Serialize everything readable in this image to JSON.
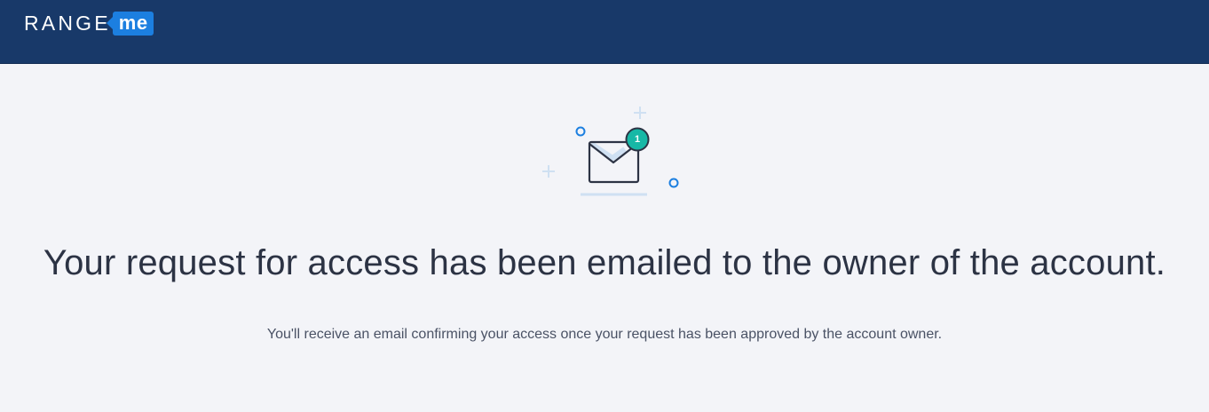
{
  "header": {
    "logo_text": "RANGE",
    "logo_badge": "me",
    "background_color": "#183969",
    "accent_color": "#1c7fe0"
  },
  "illustration": {
    "icon": "envelope-notification-icon",
    "badge_count": "1",
    "badge_color": "#17b8a6"
  },
  "main": {
    "headline": "Your request for access has been emailed to the owner of the account.",
    "subtext": "You'll receive an email confirming your access once your request has been approved by the account owner."
  }
}
